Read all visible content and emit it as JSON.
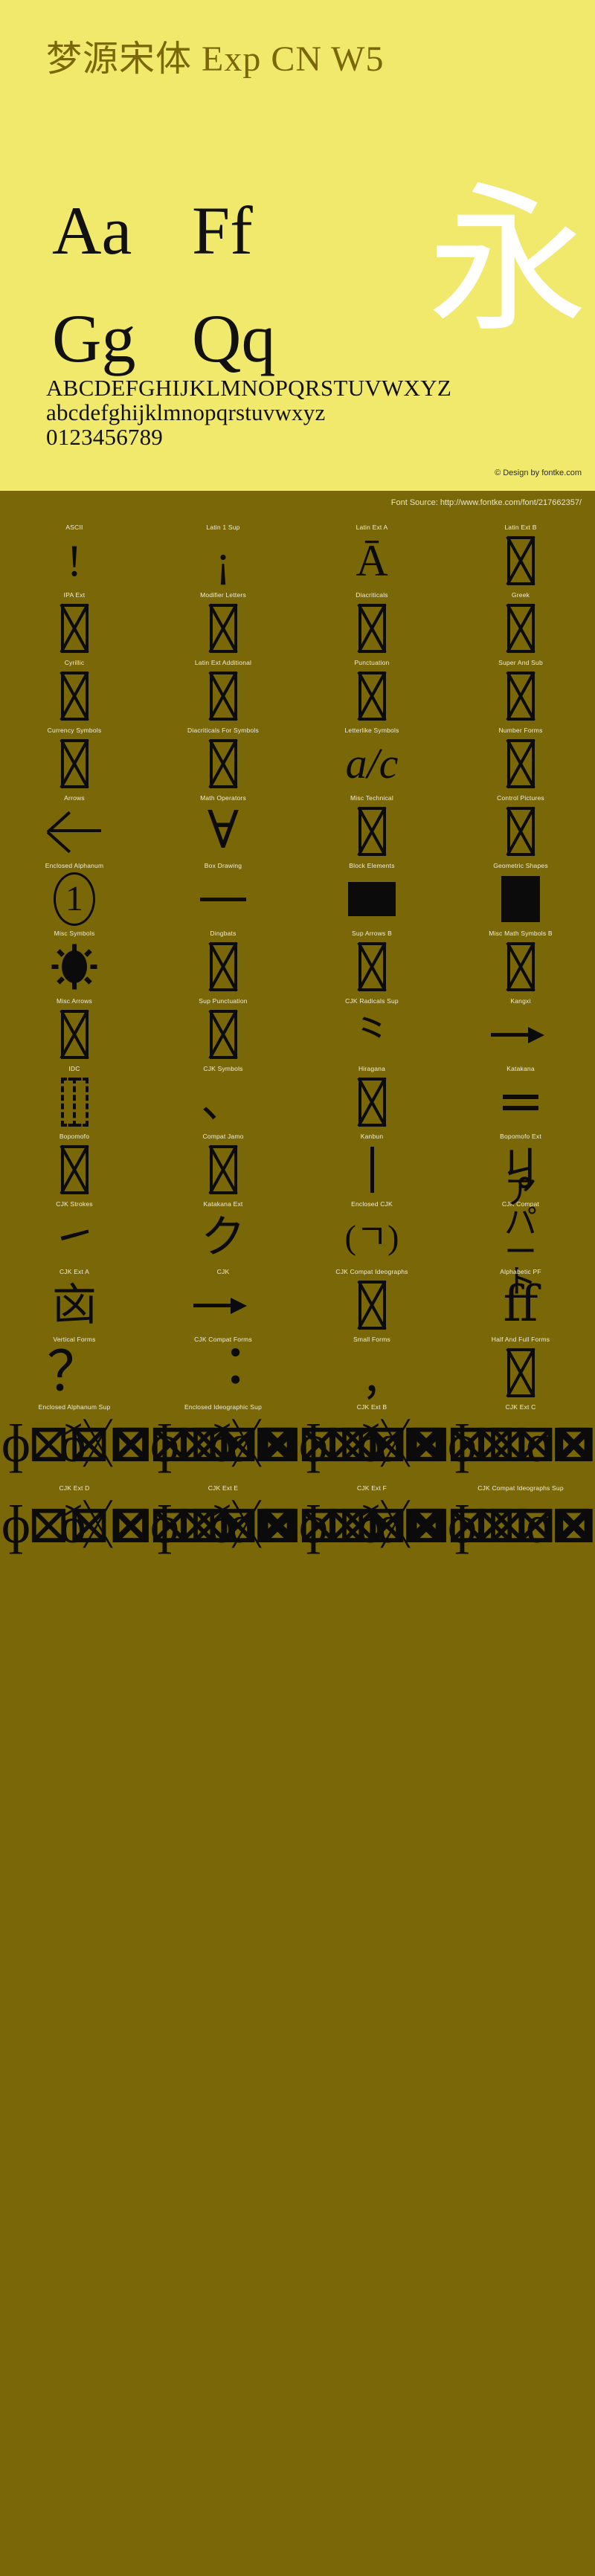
{
  "header": {
    "font_title": "梦源宋体 Exp CN W5",
    "samples": [
      {
        "upper": "Aa",
        "lower": "Ff"
      },
      {
        "upper": "Gg",
        "lower": "Qq"
      }
    ],
    "cjk_sample": "永",
    "alphabet_upper": "ABCDEFGHIJKLMNOPQRSTUVWXYZ",
    "alphabet_lower": "abcdefghijklmnopqrstuvwxyz",
    "digits": "0123456789",
    "credit": "© Design by fontke.com",
    "colors": {
      "header_bg": "#F0E96B",
      "title_color": "#7A6708",
      "body_bg": "#7A6708",
      "glyph_color": "#0B0B0B",
      "label_color": "#EFEEDD",
      "cjk_sample_color": "#FFFFFF"
    }
  },
  "source": {
    "label": "Font Source: http://www.fontke.com/font/217662357/"
  },
  "grid": {
    "rows": [
      [
        {
          "label": "ASCII",
          "glyph": "!",
          "kind": "char"
        },
        {
          "label": "Latin 1 Sup",
          "glyph": "¡",
          "kind": "char"
        },
        {
          "label": "Latin Ext A",
          "glyph": "Ā",
          "kind": "char"
        },
        {
          "label": "Latin Ext B",
          "glyph": "",
          "kind": "notdef"
        }
      ],
      [
        {
          "label": "IPA Ext",
          "glyph": "",
          "kind": "notdef"
        },
        {
          "label": "Modifier Letters",
          "glyph": "",
          "kind": "notdef"
        },
        {
          "label": "Diacriticals",
          "glyph": "",
          "kind": "notdef"
        },
        {
          "label": "Greek",
          "glyph": "",
          "kind": "notdef"
        }
      ],
      [
        {
          "label": "Cyrillic",
          "glyph": "",
          "kind": "notdef"
        },
        {
          "label": "Latin Ext Additional",
          "glyph": "",
          "kind": "notdef"
        },
        {
          "label": "Punctuation",
          "glyph": "",
          "kind": "notdef"
        },
        {
          "label": "Super And Sub",
          "glyph": "",
          "kind": "notdef"
        }
      ],
      [
        {
          "label": "Currency Symbols",
          "glyph": "",
          "kind": "notdef"
        },
        {
          "label": "Diacriticals For Symbols",
          "glyph": "",
          "kind": "notdef"
        },
        {
          "label": "Letterlike Symbols",
          "glyph": "a/c",
          "kind": "fraction"
        },
        {
          "label": "Number Forms",
          "glyph": "",
          "kind": "notdef"
        }
      ],
      [
        {
          "label": "Arrows",
          "glyph": "←",
          "kind": "arrow-left"
        },
        {
          "label": "Math Operators",
          "glyph": "∀",
          "kind": "forall"
        },
        {
          "label": "Misc Technical",
          "glyph": "",
          "kind": "notdef"
        },
        {
          "label": "Control Pictures",
          "glyph": "",
          "kind": "notdef"
        }
      ],
      [
        {
          "label": "Enclosed Alphanum",
          "glyph": "①",
          "kind": "circled-one"
        },
        {
          "label": "Box Drawing",
          "glyph": "─",
          "kind": "hline"
        },
        {
          "label": "Block Elements",
          "glyph": "█",
          "kind": "block-wide"
        },
        {
          "label": "Geometric Shapes",
          "glyph": "■",
          "kind": "block-tall"
        }
      ],
      [
        {
          "label": "Misc Symbols",
          "glyph": "☀",
          "kind": "sun"
        },
        {
          "label": "Dingbats",
          "glyph": "",
          "kind": "notdef"
        },
        {
          "label": "Sup Arrows B",
          "glyph": "",
          "kind": "notdef"
        },
        {
          "label": "Misc Math Symbols B",
          "glyph": "",
          "kind": "notdef"
        }
      ],
      [
        {
          "label": "Misc Arrows",
          "glyph": "",
          "kind": "notdef"
        },
        {
          "label": "Sup Punctuation",
          "glyph": "",
          "kind": "notdef"
        },
        {
          "label": "CJK Radicals Sup",
          "glyph": "⺀",
          "kind": "cjk"
        },
        {
          "label": "Kangxi",
          "glyph": "⼀",
          "kind": "arrow-cjk"
        }
      ],
      [
        {
          "label": "IDC",
          "glyph": "⿰",
          "kind": "idc"
        },
        {
          "label": "CJK Symbols",
          "glyph": "、",
          "kind": "cjk"
        },
        {
          "label": "Hiragana",
          "glyph": "",
          "kind": "notdef"
        },
        {
          "label": "Katakana",
          "glyph": "゠",
          "kind": "eq-lines"
        }
      ],
      [
        {
          "label": "Bopomofo",
          "glyph": "",
          "kind": "notdef"
        },
        {
          "label": "Compat Jamo",
          "glyph": "",
          "kind": "notdef"
        },
        {
          "label": "Kanbun",
          "glyph": "㇑",
          "kind": "vbar"
        },
        {
          "label": "Bopomofo Ext",
          "glyph": "ㆢ",
          "kind": "cjk"
        }
      ],
      [
        {
          "label": "CJK Strokes",
          "glyph": "㇀",
          "kind": "cjk"
        },
        {
          "label": "Katakana Ext",
          "glyph": "ク",
          "kind": "cjk"
        },
        {
          "label": "Enclosed CJK",
          "glyph": "(ㄱ)",
          "kind": "cjk-small"
        },
        {
          "label": "CJK Compat",
          "glyph": "アパート",
          "kind": "cjk-multiline"
        }
      ],
      [
        {
          "label": "CJK Ext A",
          "glyph": "㐫",
          "kind": "cjk"
        },
        {
          "label": "CJK",
          "glyph": "一",
          "kind": "arrow-cjk"
        },
        {
          "label": "CJK Compat Ideographs",
          "glyph": "",
          "kind": "notdef"
        },
        {
          "label": "Alphabetic PF",
          "glyph": "ﬀ",
          "kind": "ligature"
        }
      ],
      [
        {
          "label": "Vertical Forms",
          "glyph": "？",
          "kind": "punct"
        },
        {
          "label": "CJK Compat Forms",
          "glyph": "︓",
          "kind": "punct-colon"
        },
        {
          "label": "Small Forms",
          "glyph": "﹐",
          "kind": "punct-comma"
        },
        {
          "label": "Half And Full Forms",
          "glyph": "",
          "kind": "notdef"
        }
      ],
      [
        {
          "label": "Enclosed Alphanum Sup",
          "glyph": "",
          "kind": "dense"
        },
        {
          "label": "Enclosed Ideographic Sup",
          "glyph": "",
          "kind": "dense"
        },
        {
          "label": "CJK Ext B",
          "glyph": "",
          "kind": "dense"
        },
        {
          "label": "CJK Ext C",
          "glyph": "",
          "kind": "dense"
        }
      ],
      [
        {
          "label": "CJK Ext D",
          "glyph": "",
          "kind": "dense"
        },
        {
          "label": "CJK Ext E",
          "glyph": "",
          "kind": "dense"
        },
        {
          "label": "CJK Ext F",
          "glyph": "",
          "kind": "dense"
        },
        {
          "label": "CJK Compat Ideographs Sup",
          "glyph": "",
          "kind": "dense"
        }
      ]
    ],
    "dense_strip_top": "ðᚷ⊠ɸ⊠⊠⊠⊠⊠ɑ⊠",
    "dense_strip_bottom": "ð≪⊠⊠⊠ᚷ¬°ᚷ⊠"
  }
}
